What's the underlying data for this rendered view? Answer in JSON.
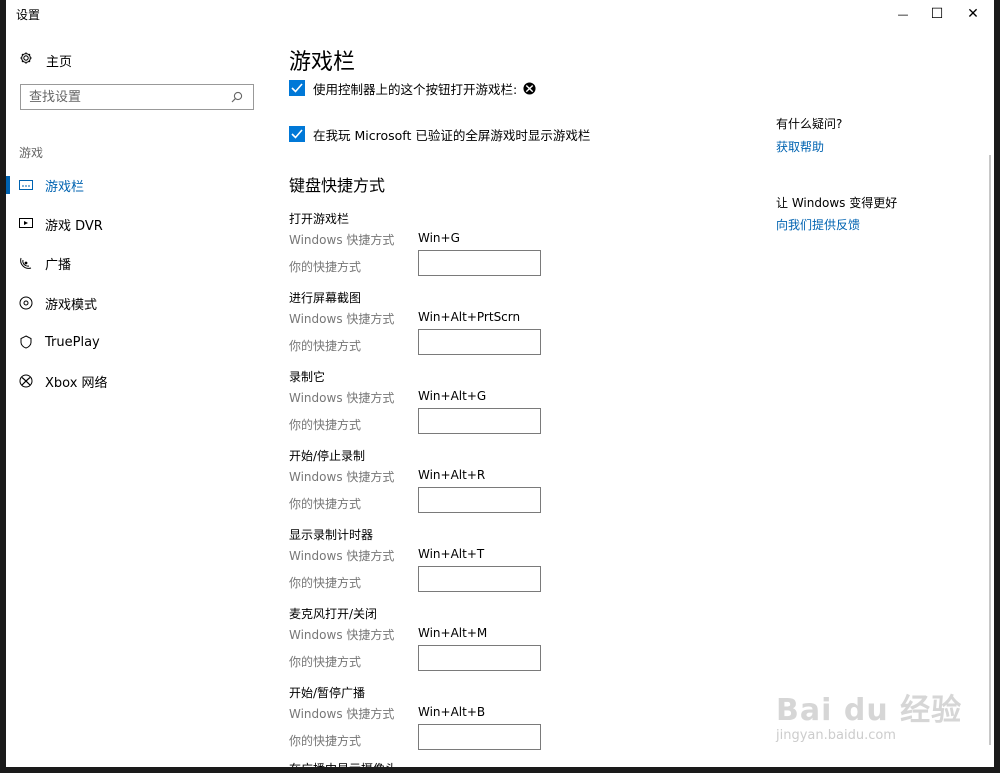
{
  "window": {
    "title": "设置",
    "minimize_glyph": "—",
    "maximize_glyph": "☐",
    "close_glyph": "✕"
  },
  "sidebar": {
    "home_label": "主页",
    "search_placeholder": "查找设置",
    "section_label": "游戏",
    "items": [
      {
        "label": "游戏栏",
        "icon": "game-bar-icon",
        "active": true
      },
      {
        "label": "游戏 DVR",
        "icon": "game-dvr-icon",
        "active": false
      },
      {
        "label": "广播",
        "icon": "broadcast-icon",
        "active": false
      },
      {
        "label": "游戏模式",
        "icon": "game-mode-icon",
        "active": false
      },
      {
        "label": "TruePlay",
        "icon": "trueplay-icon",
        "active": false
      },
      {
        "label": "Xbox 网络",
        "icon": "xbox-icon",
        "active": false
      }
    ]
  },
  "main": {
    "title": "游戏栏",
    "checkbox_controller": "使用控制器上的这个按钮打开游戏栏:",
    "checkbox_fullscreen": "在我玩 Microsoft 已验证的全屏游戏时显示游戏栏",
    "shortcuts_heading": "键盘快捷方式",
    "windows_shortcut_label": "Windows 快捷方式",
    "your_shortcut_label": "你的快捷方式",
    "shortcuts": [
      {
        "name": "打开游戏栏",
        "keys": "Win+G"
      },
      {
        "name": "进行屏幕截图",
        "keys": "Win+Alt+PrtScrn"
      },
      {
        "name": "录制它",
        "keys": "Win+Alt+G"
      },
      {
        "name": "开始/停止录制",
        "keys": "Win+Alt+R"
      },
      {
        "name": "显示录制计时器",
        "keys": "Win+Alt+T"
      },
      {
        "name": "麦克风打开/关闭",
        "keys": "Win+Alt+M"
      },
      {
        "name": "开始/暂停广播",
        "keys": "Win+Alt+B"
      }
    ],
    "cut_off_text": "在广播中显示摄像头"
  },
  "help": {
    "question_heading": "有什么疑问?",
    "get_help_link": "获取帮助",
    "improve_heading": "让 Windows 变得更好",
    "feedback_link": "向我们提供反馈"
  },
  "watermark": {
    "main": "Bai du 经验",
    "sub": "jingyan.baidu.com"
  },
  "colors": {
    "accent": "#0078d7",
    "link": "#0063b1"
  }
}
